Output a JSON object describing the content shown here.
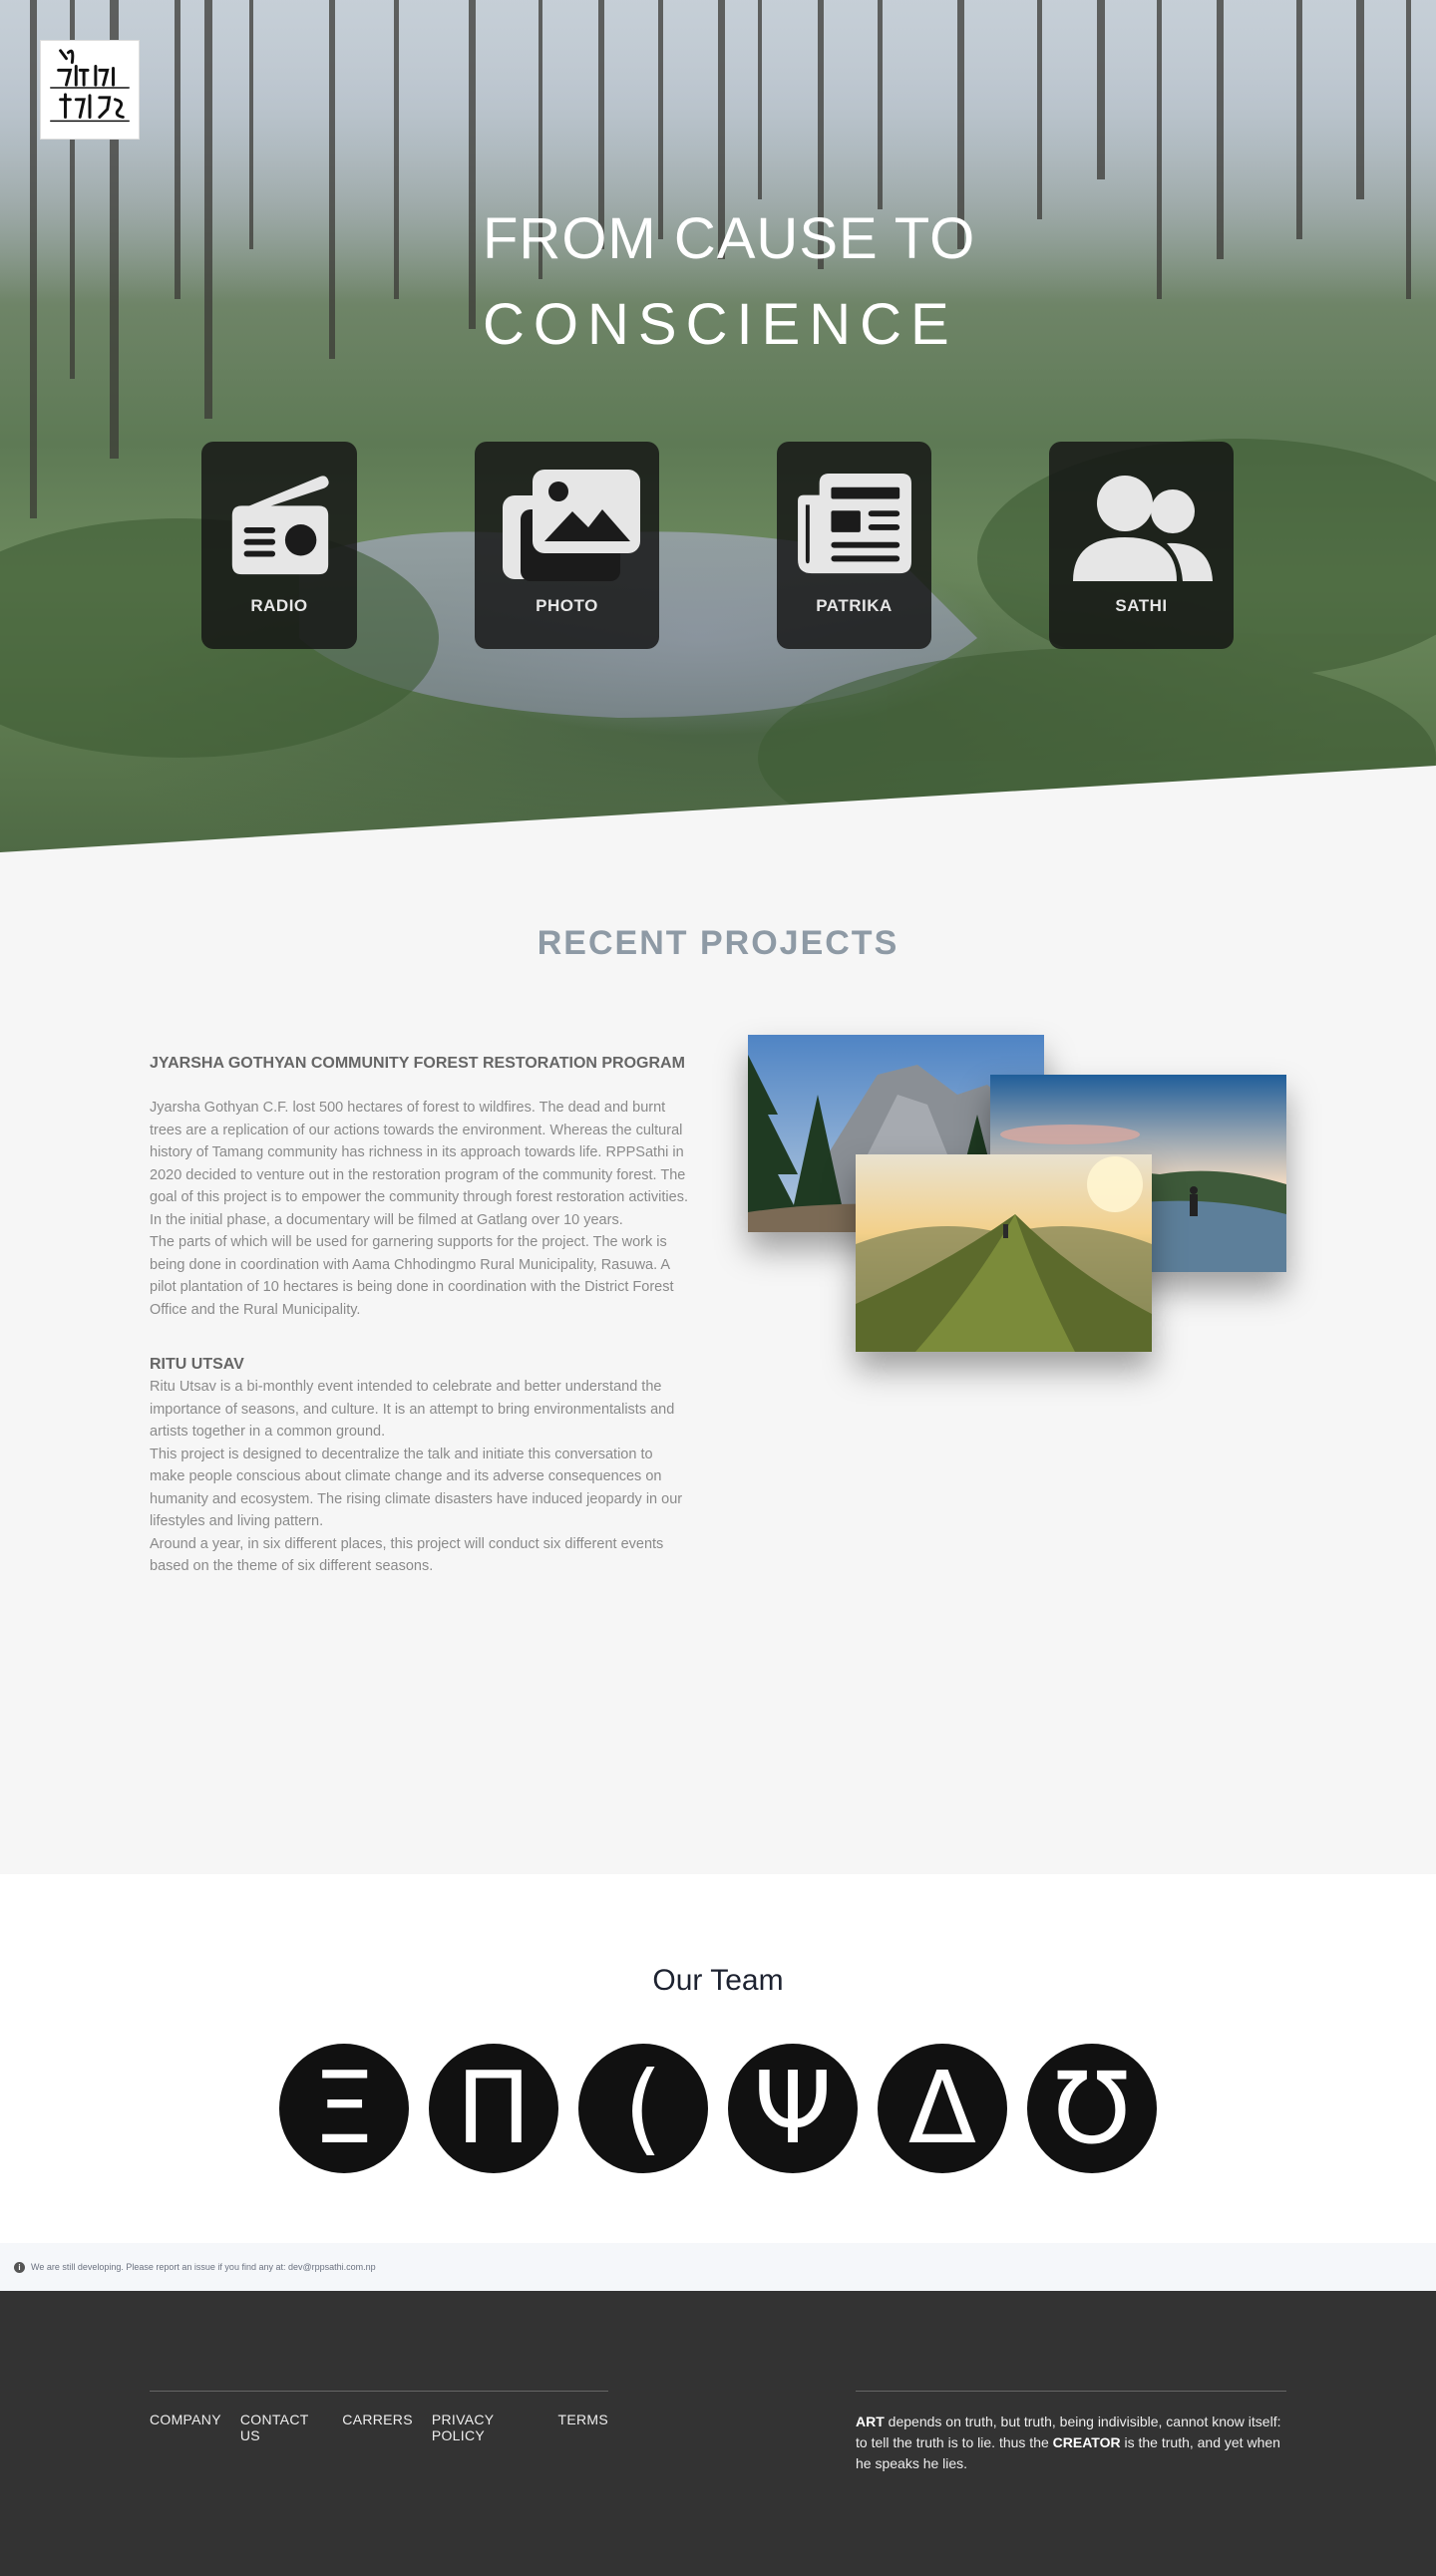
{
  "hero": {
    "logo_alt": "ट्याक्स फ्रेस",
    "title_line1": "FROM CAUSE TO",
    "title_line2": "CONSCIENCE",
    "tiles": [
      {
        "label": "RADIO",
        "icon": "radio-icon"
      },
      {
        "label": "PHOTO",
        "icon": "images-icon"
      },
      {
        "label": "PATRIKA",
        "icon": "newspaper-icon"
      },
      {
        "label": "SATHI",
        "icon": "users-icon"
      }
    ]
  },
  "projects": {
    "title": "RECENT PROJECTS",
    "items": [
      {
        "heading": "JYARSHA GOTHYAN COMMUNITY FOREST RESTORATION PROGRAM",
        "paragraphs": [
          "Jyarsha Gothyan C.F. lost 500 hectares of forest to wildfires. The dead and burnt trees are a replication of our actions towards the environment. Whereas the cultural history of Tamang community has richness in its approach towards life. RPPSathi in 2020 decided to venture out in the restoration program of the community forest. The goal of this project is to empower the community through forest restoration activities. In the initial phase, a documentary will be filmed at Gatlang over 10 years.",
          "The parts of which will be used for garnering supports for the project. The work is being done in coordination with Aama Chhodingmo Rural Municipality, Rasuwa. A pilot plantation of 10 hectares is being done in coordination with the District Forest Office and the Rural Municipality."
        ]
      },
      {
        "heading": "RITU UTSAV",
        "paragraphs": [
          "Ritu Utsav is a bi-monthly event intended to celebrate and better understand the importance of seasons, and culture. It is an attempt to bring environmentalists and artists together in a common ground.",
          "This project is designed to decentralize the talk and initiate this conversation to make people conscious about climate change and its adverse consequences on humanity and ecosystem. The rising climate disasters have induced jeopardy in our lifestyles and living pattern.",
          "Around a year, in six different places, this project will conduct six different events based on the theme of six different seasons."
        ]
      }
    ]
  },
  "team": {
    "title": "Our Team",
    "members": [
      "Ξ",
      "Π",
      "(",
      "Ψ",
      "Δ",
      "Ʊ"
    ]
  },
  "notice": {
    "text": "We are still developing. Please report an issue if you find any at: dev@rppsathi.com.np"
  },
  "footer": {
    "links": [
      "COMPANY",
      "CONTACT US",
      "CARRERS",
      "PRIVACY POLICY",
      "TERMS"
    ],
    "quote_art": "ART",
    "quote_mid": " depends on truth, but truth, being indivisible, cannot know itself: to tell the truth is to lie. thus the ",
    "quote_creator": "CREATOR",
    "quote_end": " is the truth, and yet when he speaks he lies."
  }
}
